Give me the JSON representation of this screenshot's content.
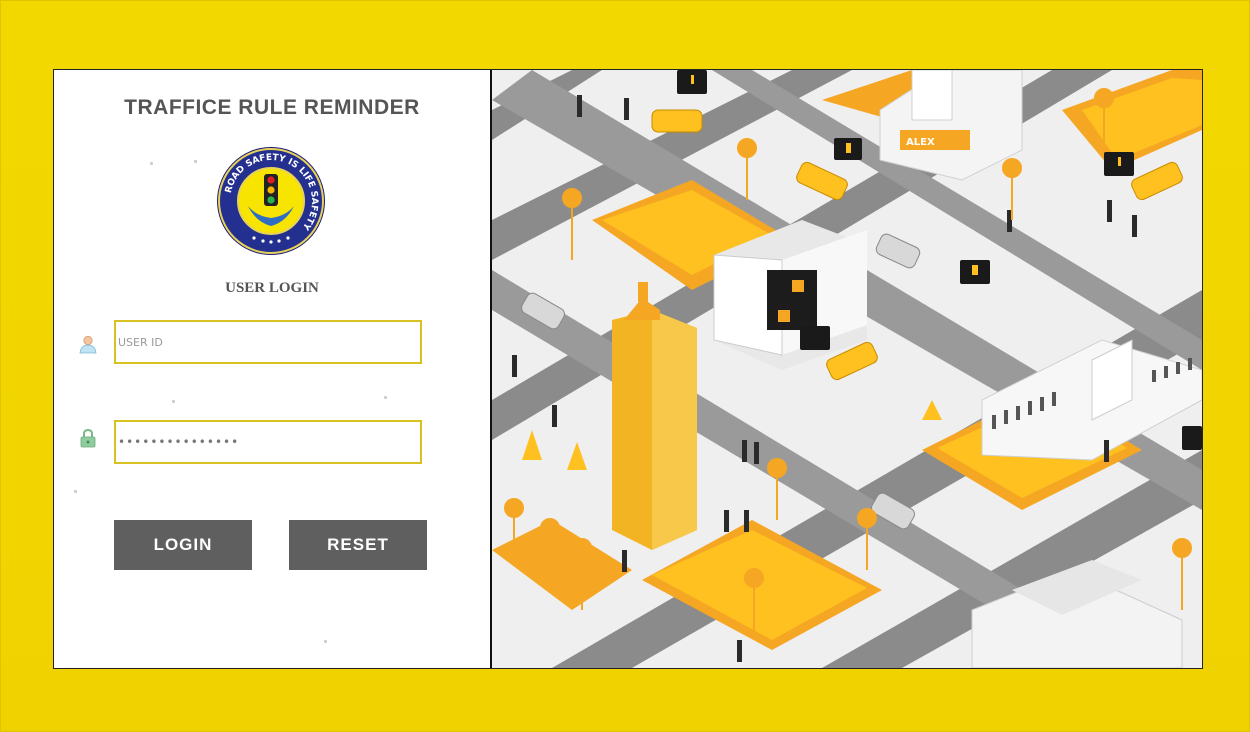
{
  "app": {
    "title": "TRAFFICE RULE REMINDER"
  },
  "logo": {
    "icon": "road-safety-badge-icon",
    "text": "ROAD SAFETY IS LIFE SAFETY"
  },
  "login": {
    "heading": "USER LOGIN",
    "user_id_placeholder": "USER ID",
    "password_value": "•••••••••••••••",
    "login_label": "LOGIN",
    "reset_label": "RESET"
  },
  "theme": {
    "background": "#f2d500",
    "button": "#5f5f5f",
    "input_border": "#d8c221",
    "title_text": "#555555"
  },
  "illustration": {
    "sign_text": "ALEX"
  }
}
